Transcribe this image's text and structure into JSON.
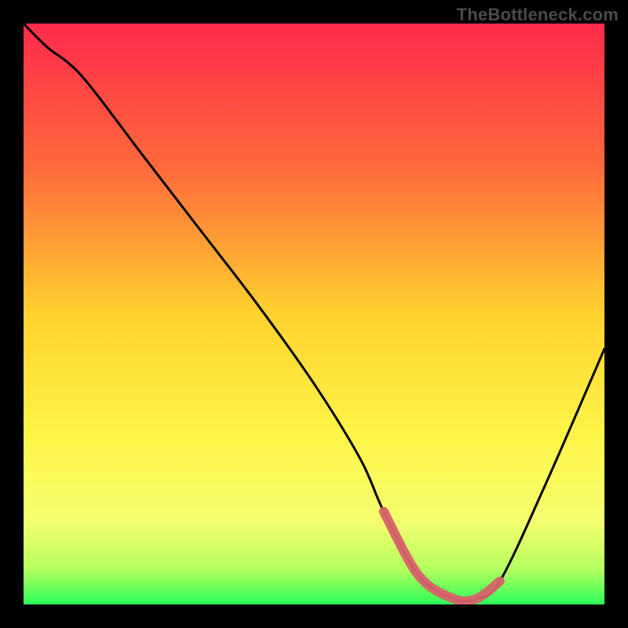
{
  "watermark": "TheBottleneck.com",
  "chart_data": {
    "type": "line",
    "title": "",
    "xlabel": "",
    "ylabel": "",
    "xlim": [
      0,
      100
    ],
    "ylim": [
      0,
      100
    ],
    "x": [
      0,
      4,
      10,
      20,
      30,
      40,
      50,
      58,
      62,
      68,
      74,
      78,
      82,
      90,
      100
    ],
    "values": [
      100,
      96,
      91,
      78,
      65,
      52,
      38,
      25,
      16,
      5,
      1,
      1,
      4,
      21,
      44
    ],
    "highlight_range_x": [
      62,
      82
    ],
    "gradient_stops": [
      {
        "offset": 0.0,
        "color": "#ff2a4b"
      },
      {
        "offset": 0.25,
        "color": "#ff6a3c"
      },
      {
        "offset": 0.5,
        "color": "#ffd22e"
      },
      {
        "offset": 0.72,
        "color": "#fff64a"
      },
      {
        "offset": 0.86,
        "color": "#f4ff70"
      },
      {
        "offset": 0.94,
        "color": "#b4ff5e"
      },
      {
        "offset": 1.0,
        "color": "#2bff5a"
      }
    ]
  },
  "colors": {
    "curve": "#000000",
    "highlight": "#d9626a",
    "background": "#000000"
  }
}
